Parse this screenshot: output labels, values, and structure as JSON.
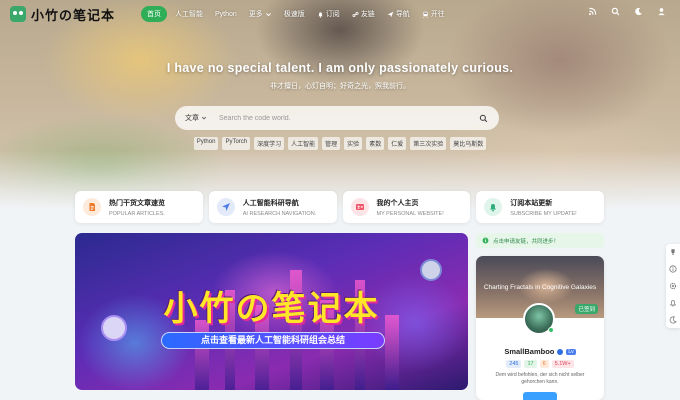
{
  "site": {
    "name": "小竹の笔记本"
  },
  "nav": {
    "items": [
      {
        "label": "首页",
        "active": true
      },
      {
        "label": "人工智能"
      },
      {
        "label": "Python"
      },
      {
        "label": "更多"
      },
      {
        "label": "极速版"
      },
      {
        "label": "订阅"
      },
      {
        "label": "友链"
      },
      {
        "label": "导航"
      },
      {
        "label": "开往"
      }
    ],
    "right_icons": [
      "rss-icon",
      "search-icon",
      "moon-icon",
      "user-icon"
    ]
  },
  "hero": {
    "slogan": "I have no special talent. I am only passionately curious.",
    "subslogan": "非才擅日，心灯自明；好奇之光，照我前行。"
  },
  "search": {
    "scope": "文章",
    "placeholder": "Search the code world."
  },
  "tags": [
    "Python",
    "PyTorch",
    "深度学习",
    "人工智能",
    "管理",
    "实验",
    "素数",
    "仁爱",
    "第三次实验",
    "莫比乌斯数"
  ],
  "quick_cards": [
    {
      "title": "热门干货文章速览",
      "subtitle": "POPULAR ARTICLES.",
      "color": "#f07a2a",
      "bg": "#fdeadb",
      "icon": "document-icon"
    },
    {
      "title": "人工智能科研导航",
      "subtitle": "AI RESEARCH NAVIGATION.",
      "color": "#4f7be6",
      "bg": "#e3ebfb",
      "icon": "navigation-icon"
    },
    {
      "title": "我的个人主页",
      "subtitle": "MY PERSONAL WEBSITE!",
      "color": "#f0566a",
      "bg": "#fde4e7",
      "icon": "id-card-icon"
    },
    {
      "title": "订阅本站更新",
      "subtitle": "SUBSCRIBE MY UPDATE!",
      "color": "#2fae7a",
      "bg": "#dff4ea",
      "icon": "bell-icon"
    }
  ],
  "banner": {
    "title": "小竹の笔记本",
    "subtitle": "点击查看最新人工智能科研组会总结"
  },
  "notice": {
    "text": "点击申请友链，共同进步！"
  },
  "profile": {
    "cover_title": "Charting Fractals in Cognitive Galaxies",
    "cover_badge": "已签到",
    "name": "SmallBamboo",
    "level": "Lv",
    "stats": [
      {
        "label": "245",
        "color": "#2f6fe0",
        "bg": "#e3ecfb"
      },
      {
        "label": "17",
        "color": "#2fae57",
        "bg": "#e2f5e8"
      },
      {
        "label": "6",
        "color": "#f07a2a",
        "bg": "#fdeadb"
      },
      {
        "label": "5.1W+",
        "color": "#e2455a",
        "bg": "#fde4e7"
      }
    ],
    "quote": "Dem wird befohlen, der sich nicht selber gehorchen kann."
  },
  "side_float_icons": [
    "trophy-icon",
    "info-icon",
    "settings-icon",
    "bell-icon",
    "moon-icon"
  ],
  "colors": {
    "accent": "#2fae57",
    "page_bg": "#f1f4f7"
  }
}
